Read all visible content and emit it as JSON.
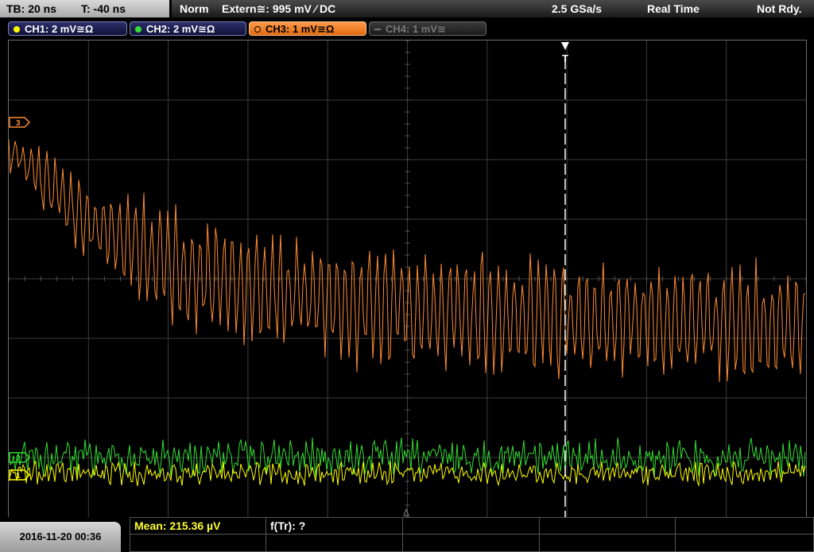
{
  "status": {
    "timebase": "TB: 20 ns",
    "trigger_offset": "T: -40 ns",
    "trigger_mode": "Norm",
    "trigger_source": "Extern≅: 995 mV ⁄ DC",
    "sample_rate": "2.5 GSa/s",
    "acq_mode": "Real Time",
    "ready_state": "Not Rdy."
  },
  "channels": [
    {
      "label": "CH1: 2 mV≅Ω",
      "color": "#ffff00",
      "active": true
    },
    {
      "label": "CH2: 2 mV≅Ω",
      "color": "#33dd33",
      "active": true
    },
    {
      "label": "CH3: 1 mV≅Ω",
      "color": "#ff8c33",
      "active": true
    },
    {
      "label": "CH4: 1 mV≅",
      "color": "#777777",
      "active": false
    }
  ],
  "markers": {
    "ch1": "1",
    "ch2": "2",
    "ch3": "3",
    "trigger": "T"
  },
  "measurements": {
    "mean": "Mean: 215.36 µV",
    "f_tr": "f(Tr): ?"
  },
  "datetime": "2016-11-20 00:36",
  "colors": {
    "ch1": "#ffff00",
    "ch2": "#33dd33",
    "ch3": "#ff8c33",
    "grid": "#5a5a5a",
    "trigger_line": "#ffffff"
  }
}
